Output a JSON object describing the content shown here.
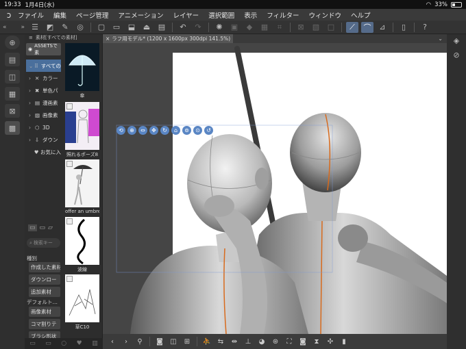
{
  "status_bar": {
    "time": "19:33",
    "date": "1月4日(水)",
    "battery": "33%"
  },
  "menu": {
    "items": [
      "ファイル",
      "編集",
      "ページ管理",
      "アニメーション",
      "レイヤー",
      "選択範囲",
      "表示",
      "フィルター",
      "ウィンドウ",
      "ヘルプ"
    ]
  },
  "material_panel": {
    "header": "素材[すべての素材]",
    "assets_label": "ASSETSで素",
    "tree": [
      {
        "label": "すべての",
        "icon": "grid-icon",
        "selected": true
      },
      {
        "label": "カラー",
        "icon": "palette-icon"
      },
      {
        "label": "単色パ",
        "icon": "swatch-icon"
      },
      {
        "label": "漫画素",
        "icon": "manga-icon"
      },
      {
        "label": "画像素",
        "icon": "image-icon"
      },
      {
        "label": "3D",
        "icon": "cube-icon"
      },
      {
        "label": "ダウン",
        "icon": "download-icon"
      },
      {
        "label": "お気に入",
        "icon": "heart-icon"
      }
    ],
    "search_placeholder": "検索キー",
    "section_kind": "種別",
    "kind_buttons": [
      "作成した素材",
      "ダウンロー",
      "追加素材"
    ],
    "section_default": "デフォルト…",
    "default_buttons": [
      "画像素材",
      "コマ割りテ",
      "ブラシ形状"
    ],
    "thumbnails": [
      {
        "caption": "傘"
      },
      {
        "caption": "照れるポーズ8"
      },
      {
        "caption": "offer an umbrella"
      },
      {
        "caption": "波線"
      },
      {
        "caption": "草C10"
      }
    ]
  },
  "canvas": {
    "doc_tab": "ラフ用モデル* (1200 x 1600px 300dpi 141.5%)"
  }
}
